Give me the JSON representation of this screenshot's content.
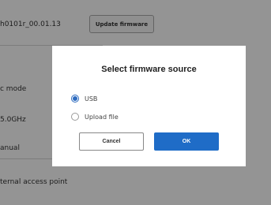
{
  "background": {
    "firmware_version": "h0101r_00.01.13",
    "update_button_label": "Update firmware",
    "mode_label": "c mode",
    "band_label": "5.0GHz",
    "manual_label": "anual",
    "access_point_label": "ternal access point"
  },
  "dialog": {
    "title": "Select firmware source",
    "options": [
      {
        "label": "USB",
        "selected": true
      },
      {
        "label": "Upload file",
        "selected": false
      }
    ],
    "cancel_label": "Cancel",
    "ok_label": "OK"
  },
  "colors": {
    "primary": "#1f6cc7",
    "overlay": "#000000"
  }
}
